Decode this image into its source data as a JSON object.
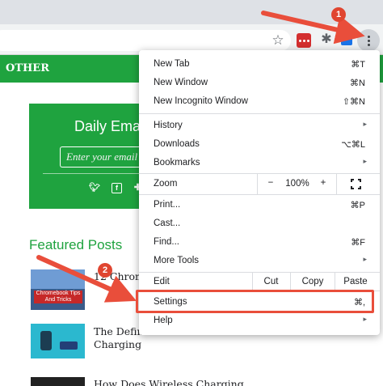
{
  "browser": {
    "icons": [
      "star-icon",
      "extension-icon",
      "puzzle-icon",
      "extension-icon",
      "kebab-menu-icon"
    ]
  },
  "site": {
    "nav_label": "OTHER",
    "signup": {
      "title": "Daily Email",
      "email_placeholder": "Enter your email",
      "social_icons": [
        "twitter-icon",
        "facebook-icon",
        "more-icon"
      ]
    },
    "featured_heading": "Featured Posts",
    "posts": [
      {
        "title_line1": "12 Chrom",
        "title_line2": ""
      },
      {
        "title_line1": "The Defin",
        "title_line2": "Charging"
      },
      {
        "title_line1": "How Does Wireless Charging",
        "title_line2": ""
      }
    ],
    "thumb1_text": "Chromebook Tips And Tricks",
    "accent_color": "#1fa33f"
  },
  "menu": {
    "new_tab": {
      "label": "New Tab",
      "shortcut": "⌘T"
    },
    "new_window": {
      "label": "New Window",
      "shortcut": "⌘N"
    },
    "new_incognito": {
      "label": "New Incognito Window",
      "shortcut": "⇧⌘N"
    },
    "history": {
      "label": "History"
    },
    "downloads": {
      "label": "Downloads",
      "shortcut": "⌥⌘L"
    },
    "bookmarks": {
      "label": "Bookmarks"
    },
    "zoom": {
      "label": "Zoom",
      "minus": "−",
      "value": "100%",
      "plus": "+"
    },
    "print": {
      "label": "Print...",
      "shortcut": "⌘P"
    },
    "cast": {
      "label": "Cast..."
    },
    "find": {
      "label": "Find...",
      "shortcut": "⌘F"
    },
    "more_tools": {
      "label": "More Tools"
    },
    "edit": {
      "label": "Edit",
      "cut": "Cut",
      "copy": "Copy",
      "paste": "Paste"
    },
    "settings": {
      "label": "Settings",
      "shortcut": "⌘,"
    },
    "help": {
      "label": "Help"
    },
    "submenu_arrow": "▸"
  },
  "annotations": {
    "step1": "1",
    "step2": "2",
    "arrow_color": "#e94e3b"
  }
}
